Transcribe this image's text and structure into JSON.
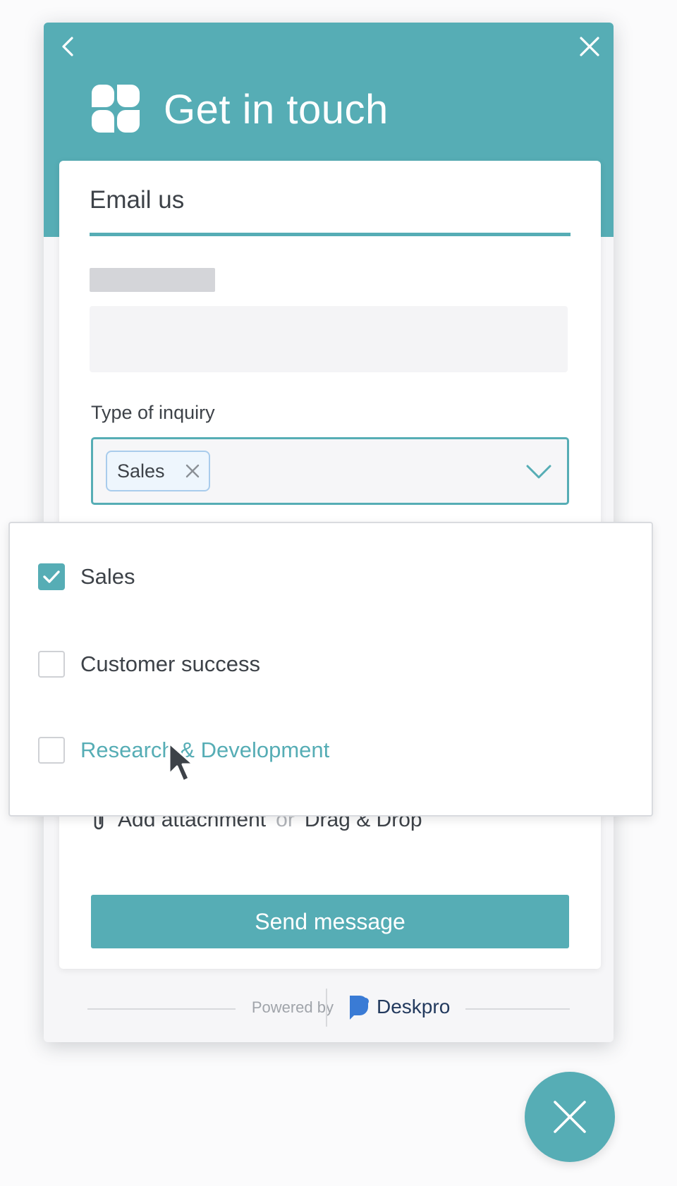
{
  "colors": {
    "accent": "#56adb5",
    "text": "#3d4248",
    "chip_bg": "#eef6fd"
  },
  "header": {
    "title": "Get in touch",
    "back_icon": "chevron-left-icon",
    "close_icon": "close-icon",
    "logo_icon": "clover-logo-icon"
  },
  "card": {
    "tab_label": "Email us",
    "inquiry_label": "Type of inquiry",
    "selected_chip": "Sales",
    "attachment": {
      "link": "Add attachment",
      "or": "or",
      "drag": "Drag & Drop"
    },
    "send_label": "Send message"
  },
  "dropdown": {
    "options": [
      {
        "label": "Sales",
        "checked": true
      },
      {
        "label": "Customer success",
        "checked": false
      },
      {
        "label": "Research & Development",
        "checked": false,
        "hovered": true
      }
    ]
  },
  "footer": {
    "powered_by": "Powered by",
    "brand": "Deskpro"
  },
  "fab": {
    "icon": "close-icon"
  }
}
